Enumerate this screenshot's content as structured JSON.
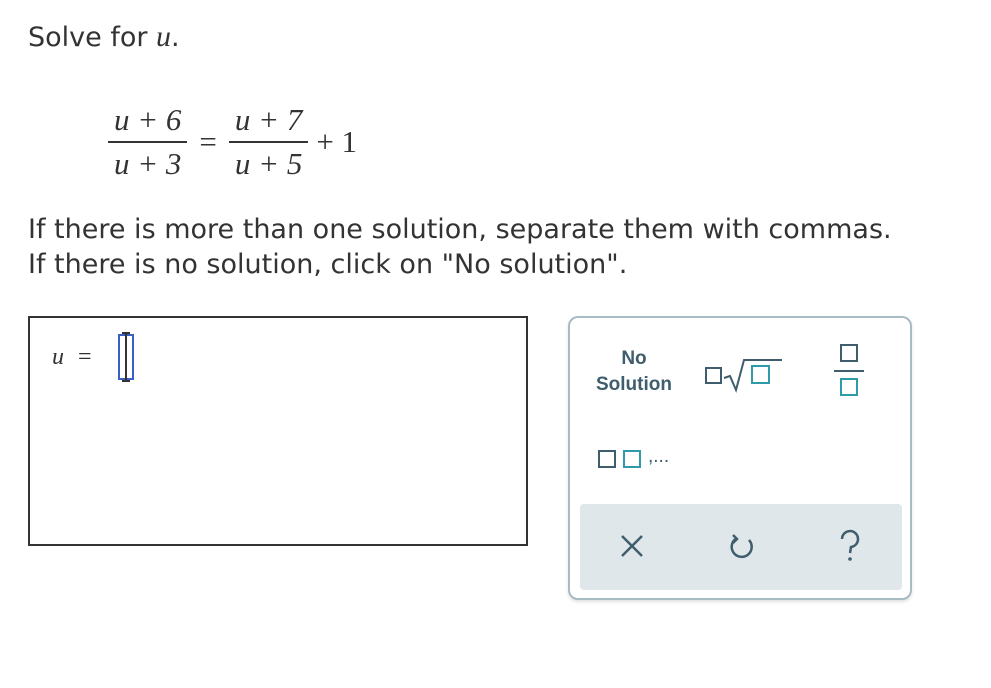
{
  "prompt": {
    "text": "Solve for ",
    "variable": "u",
    "suffix": "."
  },
  "equation": {
    "lhs_numerator": "u + 6",
    "lhs_denominator": "u + 3",
    "equals": "=",
    "rhs_numerator": "u + 7",
    "rhs_denominator": "u + 5",
    "rhs_extra": "+ 1"
  },
  "instructions": {
    "line1": "If there is more than one solution, separate them with commas.",
    "line2": "If there is no solution, click on \"No solution\"."
  },
  "answer": {
    "variable": "u",
    "equals": "=",
    "value": ""
  },
  "toolbox": {
    "no_solution_line1": "No",
    "no_solution_line2": "Solution",
    "list_ellipsis": ",...",
    "icons": [
      "nth-root-icon",
      "fraction-icon",
      "list-icon",
      "clear-icon",
      "undo-icon",
      "help-icon"
    ]
  },
  "colors": {
    "text": "#333333",
    "tool_dark": "#3f5d6d",
    "tool_teal": "#2f9aa8",
    "input_border": "#3b5fc4",
    "action_bar_bg": "#e0e7ea",
    "toolbox_border": "#a9bcc4"
  }
}
